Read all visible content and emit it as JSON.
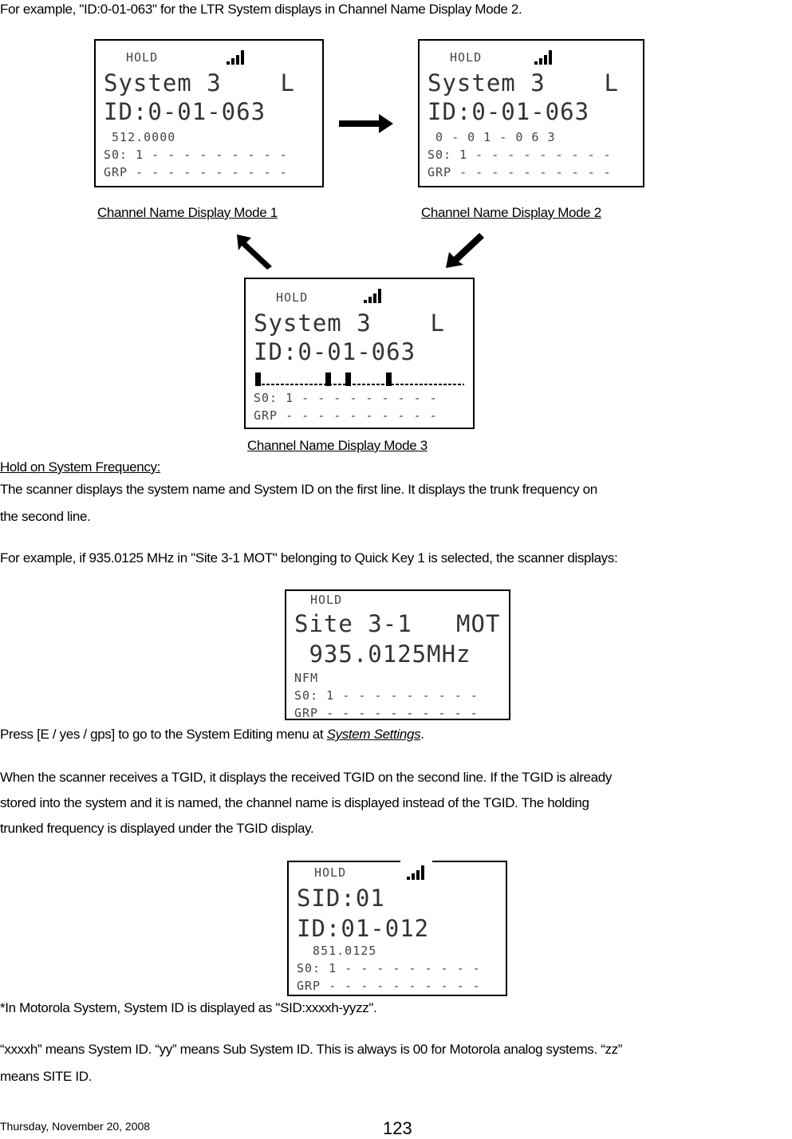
{
  "intro_text": "For example, \"ID:0-01-063\" for the LTR System displays in Channel Name Display Mode 2.",
  "displays": {
    "mode1": {
      "status": "HOLD",
      "line1": "System 3    L",
      "line2": "ID:0-01-063",
      "line3": " 512.0000",
      "line4": "S0: 1 - - - - - - - - -",
      "line5": "GRP - - - - - - - - - -",
      "caption": "Channel Name Display Mode 1"
    },
    "mode2": {
      "status": "HOLD",
      "line1": "System 3    L",
      "line2": "ID:0-01-063",
      "line3": " 0 - 0 1 - 0 6 3",
      "line4": "S0: 1 - - - - - - - - -",
      "line5": "GRP - - - - - - - - - -",
      "caption": "Channel Name Display Mode 2"
    },
    "mode3": {
      "status": "HOLD",
      "line1": "System 3    L",
      "line2": "ID:0-01-063",
      "line4": "S0: 1 - - - - - - - - -",
      "line5": "GRP - - - - - - - - - -",
      "caption": "Channel Name Display Mode 3"
    },
    "site": {
      "status": "HOLD",
      "line1": "Site 3-1   MOT",
      "line2": " 935.0125MHz",
      "line3": "NFM",
      "line4": "S0: 1 - - - - - - - - -",
      "line5": "GRP - - - - - - - - - -"
    },
    "sid": {
      "status": "HOLD",
      "line1": "SID:01",
      "line2": "ID:01-012",
      "line3": "  851.0125",
      "line4": "S0: 1 - - - - - - - - -",
      "line5": "GRP - - - - - - - - - -"
    }
  },
  "section_heading": "Hold on System Frequency:",
  "para1_line1": "The scanner displays the system name and System ID on the first line. It displays the trunk frequency on",
  "para1_line2": "the second line.",
  "para2": "For example, if 935.0125 MHz in \"Site 3-1 MOT\" belonging to Quick Key 1 is selected, the scanner displays:",
  "press_prefix": "Press [E / yes / gps] to go to the System Editing menu at ",
  "press_link": "System Settings",
  "press_suffix": ".",
  "para3_line1": "When the scanner receives a TGID, it displays the received TGID on the second line. If the TGID is already",
  "para3_line2": "stored into the system and it is named, the channel name is displayed instead of the TGID. The holding",
  "para3_line3": "trunked frequency is displayed under the TGID display.",
  "note1": "*In Motorola System, System ID is displayed as \"SID:xxxxh-yyzz\".",
  "note2_line1": "“xxxxh” means System ID. “yy” means Sub System ID. This is always is 00 for Motorola analog systems. “zz”",
  "note2_line2": "means SITE ID.",
  "footer": {
    "date": "Thursday, November 20, 2008",
    "page_number": "123"
  }
}
